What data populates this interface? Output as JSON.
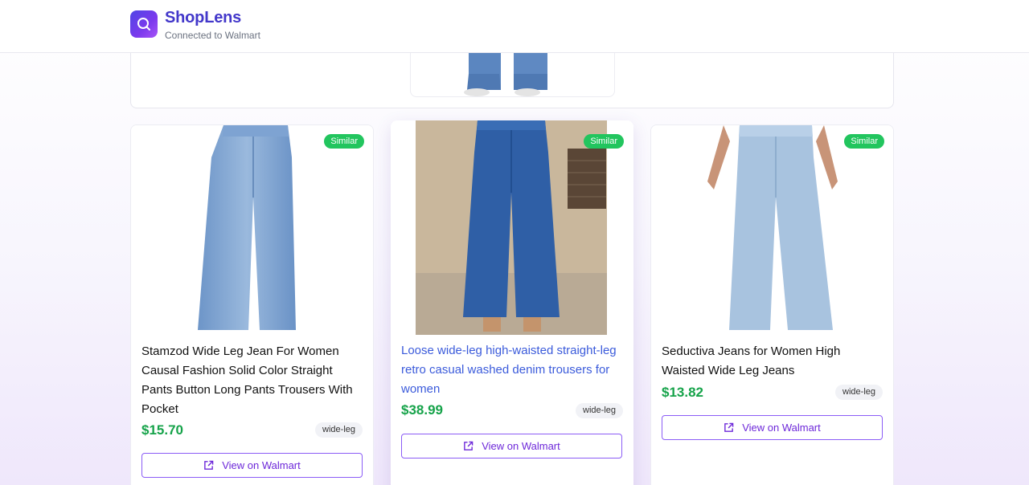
{
  "header": {
    "brand": "ShopLens",
    "subtitle": "Connected to Walmart"
  },
  "products": [
    {
      "badge": "Similar",
      "title": "Stamzod Wide Leg Jean For Women Causal Fashion Solid Color Straight Pants Button Long Pants Trousers With Pocket",
      "price": "$15.70",
      "tag": "wide-leg",
      "button": "View on Walmart"
    },
    {
      "badge": "Similar",
      "title": "Loose wide-leg high-waisted straight-leg retro casual washed denim trousers for women",
      "price": "$38.99",
      "tag": "wide-leg",
      "button": "View on Walmart"
    },
    {
      "badge": "Similar",
      "title": "Seductiva Jeans for Women High Waisted Wide Leg Jeans",
      "price": "$13.82",
      "tag": "wide-leg",
      "button": "View on Walmart"
    }
  ],
  "colors": {
    "accent": "#7c3aed",
    "brand": "#4338ca",
    "price": "#16a34a",
    "badge": "#22c55e"
  },
  "icons": [
    "search-icon",
    "external-link-icon"
  ]
}
